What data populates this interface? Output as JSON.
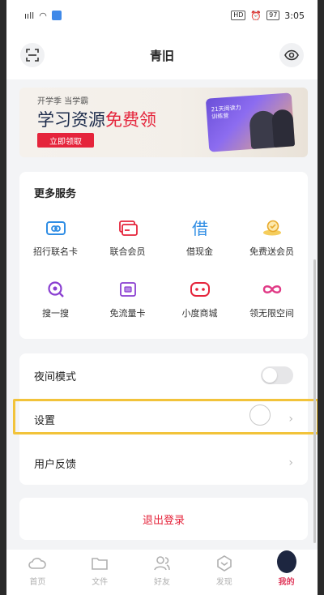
{
  "status_bar": {
    "signal": "ııll",
    "hd": "HD",
    "battery": "97",
    "time": "3:05"
  },
  "header": {
    "title": "青旧",
    "left_icon": "scan-icon",
    "right_icon": "eye-icon"
  },
  "banner": {
    "small_text": "开学季 当学霸",
    "title_part1": "学习资源",
    "title_highlight": "免费领",
    "button": "立即领取",
    "art_caption": "21天阅读力训练营"
  },
  "services": {
    "heading": "更多服务",
    "items": [
      {
        "label": "招行联名卡",
        "icon": "card-link-icon",
        "color": "#2f8de4"
      },
      {
        "label": "联合会员",
        "icon": "member-card-icon",
        "color": "#e5243b"
      },
      {
        "label": "借现金",
        "icon": "borrow-icon",
        "color": "#2f8de4"
      },
      {
        "label": "免费送会员",
        "icon": "gift-member-icon",
        "color": "#e8a92b"
      },
      {
        "label": "搜一搜",
        "icon": "search-icon",
        "color": "#8a3fd1"
      },
      {
        "label": "免流量卡",
        "icon": "sim-card-icon",
        "color": "#8a3fd1"
      },
      {
        "label": "小度商城",
        "icon": "store-icon",
        "color": "#e5243b"
      },
      {
        "label": "领无限空间",
        "icon": "infinity-icon",
        "color": "#e03a86"
      }
    ]
  },
  "settings": {
    "night_mode": "夜间模式",
    "settings": "设置",
    "feedback": "用户反馈"
  },
  "logout": "退出登录",
  "tabs": [
    {
      "label": "首页",
      "icon": "home-cloud-icon"
    },
    {
      "label": "文件",
      "icon": "folder-icon"
    },
    {
      "label": "好友",
      "icon": "friends-icon"
    },
    {
      "label": "发现",
      "icon": "discover-icon"
    },
    {
      "label": "我的",
      "icon": "avatar-icon"
    }
  ],
  "colors": {
    "accent": "#e5243b",
    "highlight_border": "#f2c33a"
  }
}
